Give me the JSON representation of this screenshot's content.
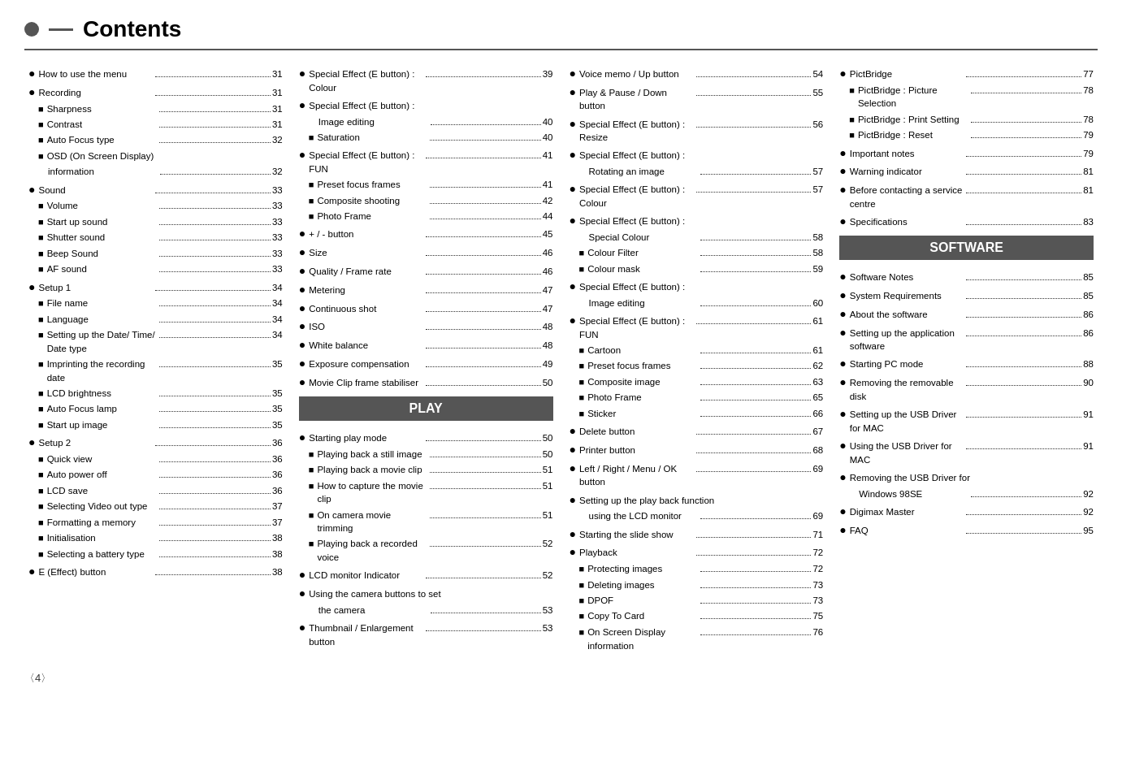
{
  "header": {
    "title": "Contents"
  },
  "col1": {
    "items": [
      {
        "type": "circle",
        "text": "How to use the menu",
        "dots": true,
        "page": "31"
      },
      {
        "type": "circle",
        "text": "Recording",
        "dots": true,
        "page": "31"
      },
      {
        "type": "square",
        "text": "Sharpness",
        "dots": true,
        "page": "31"
      },
      {
        "type": "square",
        "text": "Contrast",
        "dots": true,
        "page": "31"
      },
      {
        "type": "square",
        "text": "Auto Focus type",
        "dots": true,
        "page": "32"
      },
      {
        "type": "square",
        "text": "OSD (On Screen Display)",
        "dots": false,
        "page": ""
      },
      {
        "type": "indent",
        "text": "information",
        "dots": true,
        "page": "32"
      },
      {
        "type": "circle",
        "text": "Sound",
        "dots": true,
        "page": "33"
      },
      {
        "type": "square",
        "text": "Volume",
        "dots": true,
        "page": "33"
      },
      {
        "type": "square",
        "text": "Start up sound",
        "dots": true,
        "page": "33"
      },
      {
        "type": "square",
        "text": "Shutter sound",
        "dots": true,
        "page": "33"
      },
      {
        "type": "square",
        "text": "Beep Sound",
        "dots": true,
        "page": "33"
      },
      {
        "type": "square",
        "text": "AF sound",
        "dots": true,
        "page": "33"
      },
      {
        "type": "circle",
        "text": "Setup 1",
        "dots": true,
        "page": "34"
      },
      {
        "type": "square",
        "text": "File name",
        "dots": true,
        "page": "34"
      },
      {
        "type": "square",
        "text": "Language",
        "dots": true,
        "page": "34"
      },
      {
        "type": "square",
        "text": "Setting up the Date/ Time/ Date type",
        "dots": true,
        "page": "34"
      },
      {
        "type": "square",
        "text": "Imprinting the recording date",
        "dots": true,
        "page": "35"
      },
      {
        "type": "square",
        "text": "LCD brightness",
        "dots": true,
        "page": "35"
      },
      {
        "type": "square",
        "text": "Auto Focus lamp",
        "dots": true,
        "page": "35"
      },
      {
        "type": "square",
        "text": "Start up image",
        "dots": true,
        "page": "35"
      },
      {
        "type": "circle",
        "text": "Setup 2",
        "dots": true,
        "page": "36"
      },
      {
        "type": "square",
        "text": "Quick view",
        "dots": true,
        "page": "36"
      },
      {
        "type": "square",
        "text": "Auto power off",
        "dots": true,
        "page": "36"
      },
      {
        "type": "square",
        "text": "LCD save",
        "dots": true,
        "page": "36"
      },
      {
        "type": "square",
        "text": "Selecting Video out type",
        "dots": true,
        "page": "37"
      },
      {
        "type": "square",
        "text": "Formatting a memory",
        "dots": true,
        "page": "37"
      },
      {
        "type": "square",
        "text": "Initialisation",
        "dots": true,
        "page": "38"
      },
      {
        "type": "square",
        "text": "Selecting a battery type",
        "dots": true,
        "page": "38"
      },
      {
        "type": "circle",
        "text": "E (Effect) button",
        "dots": true,
        "page": "38"
      }
    ]
  },
  "col2": {
    "section": "PLAY",
    "items_pre": [
      {
        "type": "circle",
        "text": "Special Effect (E button) : Colour",
        "dots": true,
        "page": "39"
      },
      {
        "type": "circle",
        "text": "Special Effect (E button) :",
        "dots": false,
        "page": ""
      },
      {
        "type": "indent",
        "text": "Image editing",
        "dots": true,
        "page": "40"
      },
      {
        "type": "square",
        "text": "Saturation",
        "dots": true,
        "page": "40"
      },
      {
        "type": "circle",
        "text": "Special Effect (E button) : FUN",
        "dots": true,
        "page": "41"
      },
      {
        "type": "square",
        "text": "Preset focus frames",
        "dots": true,
        "page": "41"
      },
      {
        "type": "square",
        "text": "Composite shooting",
        "dots": true,
        "page": "42"
      },
      {
        "type": "square",
        "text": "Photo Frame",
        "dots": true,
        "page": "44"
      },
      {
        "type": "circle",
        "text": "+ / - button",
        "dots": true,
        "page": "45"
      },
      {
        "type": "circle",
        "text": "Size",
        "dots": true,
        "page": "46"
      },
      {
        "type": "circle",
        "text": "Quality / Frame rate",
        "dots": true,
        "page": "46"
      },
      {
        "type": "circle",
        "text": "Metering",
        "dots": true,
        "page": "47"
      },
      {
        "type": "circle",
        "text": "Continuous shot",
        "dots": true,
        "page": "47"
      },
      {
        "type": "circle",
        "text": "ISO",
        "dots": true,
        "page": "48"
      },
      {
        "type": "circle",
        "text": "White balance",
        "dots": true,
        "page": "48"
      },
      {
        "type": "circle",
        "text": "Exposure compensation",
        "dots": true,
        "page": "49"
      },
      {
        "type": "circle",
        "text": "Movie Clip frame stabiliser",
        "dots": true,
        "page": "50"
      }
    ],
    "items_play": [
      {
        "type": "circle",
        "text": "Starting play mode",
        "dots": true,
        "page": "50"
      },
      {
        "type": "square",
        "text": "Playing back a still image",
        "dots": true,
        "page": "50"
      },
      {
        "type": "square",
        "text": "Playing back a movie clip",
        "dots": true,
        "page": "51"
      },
      {
        "type": "square",
        "text": "How to capture the movie clip",
        "dots": true,
        "page": "51"
      },
      {
        "type": "square",
        "text": "On camera movie trimming",
        "dots": true,
        "page": "51"
      },
      {
        "type": "square",
        "text": "Playing back a recorded voice",
        "dots": true,
        "page": "52"
      },
      {
        "type": "circle",
        "text": "LCD  monitor Indicator",
        "dots": true,
        "page": "52"
      },
      {
        "type": "circle",
        "text": "Using the camera buttons to set",
        "dots": false,
        "page": ""
      },
      {
        "type": "indent",
        "text": "the camera",
        "dots": true,
        "page": "53"
      },
      {
        "type": "circle",
        "text": "Thumbnail / Enlargement button",
        "dots": true,
        "page": "53"
      }
    ]
  },
  "col3": {
    "items": [
      {
        "type": "circle",
        "text": "Voice memo / Up button",
        "dots": true,
        "page": "54"
      },
      {
        "type": "circle",
        "text": "Play & Pause / Down button",
        "dots": true,
        "page": "55"
      },
      {
        "type": "circle",
        "text": "Special Effect (E button) : Resize",
        "dots": true,
        "page": "56"
      },
      {
        "type": "circle",
        "text": "Special Effect (E button) :",
        "dots": false,
        "page": ""
      },
      {
        "type": "indent",
        "text": "Rotating an image",
        "dots": true,
        "page": "57"
      },
      {
        "type": "circle",
        "text": "Special Effect (E button) : Colour",
        "dots": true,
        "page": "57"
      },
      {
        "type": "circle",
        "text": "Special Effect (E button) :",
        "dots": false,
        "page": ""
      },
      {
        "type": "indent",
        "text": "Special Colour",
        "dots": true,
        "page": "58"
      },
      {
        "type": "square",
        "text": "Colour Filter",
        "dots": true,
        "page": "58"
      },
      {
        "type": "square",
        "text": "Colour mask",
        "dots": true,
        "page": "59"
      },
      {
        "type": "circle",
        "text": "Special Effect (E button) :",
        "dots": false,
        "page": ""
      },
      {
        "type": "indent",
        "text": "Image editing",
        "dots": true,
        "page": "60"
      },
      {
        "type": "circle",
        "text": "Special Effect (E button) : FUN",
        "dots": true,
        "page": "61"
      },
      {
        "type": "square",
        "text": "Cartoon",
        "dots": true,
        "page": "61"
      },
      {
        "type": "square",
        "text": "Preset focus frames",
        "dots": true,
        "page": "62"
      },
      {
        "type": "square",
        "text": "Composite image",
        "dots": true,
        "page": "63"
      },
      {
        "type": "square",
        "text": "Photo Frame",
        "dots": true,
        "page": "65"
      },
      {
        "type": "square",
        "text": "Sticker",
        "dots": true,
        "page": "66"
      },
      {
        "type": "circle",
        "text": "Delete button",
        "dots": true,
        "page": "67"
      },
      {
        "type": "circle",
        "text": "Printer button",
        "dots": true,
        "page": "68"
      },
      {
        "type": "circle",
        "text": "Left / Right / Menu / OK button",
        "dots": true,
        "page": "69"
      },
      {
        "type": "circle",
        "text": "Setting up the play back function",
        "dots": false,
        "page": ""
      },
      {
        "type": "indent",
        "text": "using the LCD monitor",
        "dots": true,
        "page": "69"
      },
      {
        "type": "circle",
        "text": "Starting the slide show",
        "dots": true,
        "page": "71"
      },
      {
        "type": "circle",
        "text": "Playback",
        "dots": true,
        "page": "72"
      },
      {
        "type": "square",
        "text": "Protecting images",
        "dots": true,
        "page": "72"
      },
      {
        "type": "square",
        "text": "Deleting images",
        "dots": true,
        "page": "73"
      },
      {
        "type": "square",
        "text": "DPOF",
        "dots": true,
        "page": "73"
      },
      {
        "type": "square",
        "text": "Copy To Card",
        "dots": true,
        "page": "75"
      },
      {
        "type": "square",
        "text": "On Screen Display information",
        "dots": true,
        "page": "76"
      }
    ]
  },
  "col4": {
    "items_pre": [
      {
        "type": "circle",
        "text": "PictBridge",
        "dots": true,
        "page": "77"
      },
      {
        "type": "square",
        "text": "PictBridge : Picture Selection",
        "dots": true,
        "page": "78"
      },
      {
        "type": "square",
        "text": "PictBridge : Print Setting",
        "dots": true,
        "page": "78"
      },
      {
        "type": "square",
        "text": "PictBridge : Reset",
        "dots": true,
        "page": "79"
      },
      {
        "type": "circle",
        "text": "Important notes",
        "dots": true,
        "page": "79"
      },
      {
        "type": "circle",
        "text": "Warning indicator",
        "dots": true,
        "page": "81"
      },
      {
        "type": "circle",
        "text": "Before contacting a service centre",
        "dots": true,
        "page": "81"
      },
      {
        "type": "circle",
        "text": "Specifications",
        "dots": true,
        "page": "83"
      }
    ],
    "section": "SOFTWARE",
    "items_sw": [
      {
        "type": "circle",
        "text": "Software Notes",
        "dots": true,
        "page": "85"
      },
      {
        "type": "circle",
        "text": "System Requirements",
        "dots": true,
        "page": "85"
      },
      {
        "type": "circle",
        "text": "About the software",
        "dots": true,
        "page": "86"
      },
      {
        "type": "circle",
        "text": "Setting up the application software",
        "dots": true,
        "page": "86"
      },
      {
        "type": "circle",
        "text": "Starting PC mode",
        "dots": true,
        "page": "88"
      },
      {
        "type": "circle",
        "text": "Removing the removable disk",
        "dots": true,
        "page": "90"
      },
      {
        "type": "circle",
        "text": "Setting up the USB Driver for MAC",
        "dots": true,
        "page": "91"
      },
      {
        "type": "circle",
        "text": "Using the USB Driver for MAC",
        "dots": true,
        "page": "91"
      },
      {
        "type": "circle",
        "text": "Removing the USB Driver for",
        "dots": false,
        "page": ""
      },
      {
        "type": "indent",
        "text": "Windows 98SE",
        "dots": true,
        "page": "92"
      },
      {
        "type": "circle",
        "text": "Digimax Master",
        "dots": true,
        "page": "92"
      },
      {
        "type": "circle",
        "text": "FAQ",
        "dots": true,
        "page": "95"
      }
    ]
  },
  "footer": {
    "page": "〈4〉"
  }
}
